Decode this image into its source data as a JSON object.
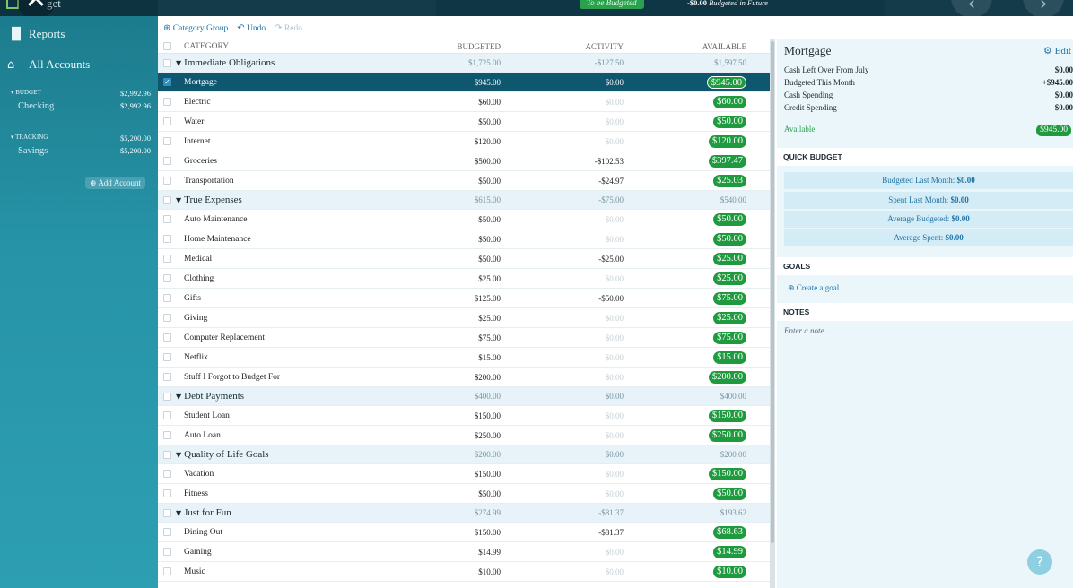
{
  "top": {
    "logo_text": "get",
    "to_be_budgeted": "To be Budgeted",
    "future_amount": "-$0.00",
    "future_label": "Budgeted in Future"
  },
  "sidebar": {
    "reports": "Reports",
    "all_accounts": "All Accounts",
    "budget_head": "BUDGET",
    "budget_total": "$2,992.96",
    "checking": "Checking",
    "checking_amt": "$2,992.96",
    "tracking_head": "TRACKING",
    "tracking_total": "$5,200.00",
    "savings": "Savings",
    "savings_amt": "$5,200.00",
    "add_account": "Add Account"
  },
  "toolbar": {
    "category_group": "Category Group",
    "undo": "Undo",
    "redo": "Redo"
  },
  "columns": {
    "category": "CATEGORY",
    "budgeted": "BUDGETED",
    "activity": "ACTIVITY",
    "available": "AVAILABLE"
  },
  "rows": [
    {
      "type": "group",
      "name": "Immediate Obligations",
      "budgeted": "$1,725.00",
      "activity": "-$127.50",
      "available": "$1,597.50"
    },
    {
      "type": "cat",
      "name": "Mortgage",
      "budgeted": "$945.00",
      "activity": "$0.00",
      "available": "$945.00",
      "selected": true
    },
    {
      "type": "cat",
      "name": "Electric",
      "budgeted": "$60.00",
      "activity": "$0.00",
      "available": "$60.00"
    },
    {
      "type": "cat",
      "name": "Water",
      "budgeted": "$50.00",
      "activity": "$0.00",
      "available": "$50.00"
    },
    {
      "type": "cat",
      "name": "Internet",
      "budgeted": "$120.00",
      "activity": "$0.00",
      "available": "$120.00"
    },
    {
      "type": "cat",
      "name": "Groceries",
      "budgeted": "$500.00",
      "activity": "-$102.53",
      "available": "$397.47"
    },
    {
      "type": "cat",
      "name": "Transportation",
      "budgeted": "$50.00",
      "activity": "-$24.97",
      "available": "$25.03"
    },
    {
      "type": "group",
      "name": "True Expenses",
      "budgeted": "$615.00",
      "activity": "-$75.00",
      "available": "$540.00"
    },
    {
      "type": "cat",
      "name": "Auto Maintenance",
      "budgeted": "$50.00",
      "activity": "$0.00",
      "available": "$50.00"
    },
    {
      "type": "cat",
      "name": "Home Maintenance",
      "budgeted": "$50.00",
      "activity": "$0.00",
      "available": "$50.00"
    },
    {
      "type": "cat",
      "name": "Medical",
      "budgeted": "$50.00",
      "activity": "-$25.00",
      "available": "$25.00"
    },
    {
      "type": "cat",
      "name": "Clothing",
      "budgeted": "$25.00",
      "activity": "$0.00",
      "available": "$25.00"
    },
    {
      "type": "cat",
      "name": "Gifts",
      "budgeted": "$125.00",
      "activity": "-$50.00",
      "available": "$75.00"
    },
    {
      "type": "cat",
      "name": "Giving",
      "budgeted": "$25.00",
      "activity": "$0.00",
      "available": "$25.00"
    },
    {
      "type": "cat",
      "name": "Computer Replacement",
      "budgeted": "$75.00",
      "activity": "$0.00",
      "available": "$75.00"
    },
    {
      "type": "cat",
      "name": "Netflix",
      "budgeted": "$15.00",
      "activity": "$0.00",
      "available": "$15.00"
    },
    {
      "type": "cat",
      "name": "Stuff I Forgot to Budget For",
      "budgeted": "$200.00",
      "activity": "$0.00",
      "available": "$200.00"
    },
    {
      "type": "group",
      "name": "Debt Payments",
      "budgeted": "$400.00",
      "activity": "$0.00",
      "available": "$400.00"
    },
    {
      "type": "cat",
      "name": "Student Loan",
      "budgeted": "$150.00",
      "activity": "$0.00",
      "available": "$150.00"
    },
    {
      "type": "cat",
      "name": "Auto Loan",
      "budgeted": "$250.00",
      "activity": "$0.00",
      "available": "$250.00"
    },
    {
      "type": "group",
      "name": "Quality of Life Goals",
      "budgeted": "$200.00",
      "activity": "$0.00",
      "available": "$200.00"
    },
    {
      "type": "cat",
      "name": "Vacation",
      "budgeted": "$150.00",
      "activity": "$0.00",
      "available": "$150.00"
    },
    {
      "type": "cat",
      "name": "Fitness",
      "budgeted": "$50.00",
      "activity": "$0.00",
      "available": "$50.00"
    },
    {
      "type": "group",
      "name": "Just for Fun",
      "budgeted": "$274.99",
      "activity": "-$81.37",
      "available": "$193.62"
    },
    {
      "type": "cat",
      "name": "Dining Out",
      "budgeted": "$150.00",
      "activity": "-$81.37",
      "available": "$68.63"
    },
    {
      "type": "cat",
      "name": "Gaming",
      "budgeted": "$14.99",
      "activity": "$0.00",
      "available": "$14.99"
    },
    {
      "type": "cat",
      "name": "Music",
      "budgeted": "$10.00",
      "activity": "$0.00",
      "available": "$10.00"
    }
  ],
  "inspector": {
    "title": "Mortgage",
    "edit": "Edit",
    "cash_left_label": "Cash Left Over From July",
    "cash_left": "$0.00",
    "budgeted_label": "Budgeted This Month",
    "budgeted": "+$945.00",
    "cash_spending_label": "Cash Spending",
    "cash_spending": "$0.00",
    "credit_spending_label": "Credit Spending",
    "credit_spending": "$0.00",
    "available_label": "Available",
    "available": "$945.00",
    "quick_budget": "QUICK BUDGET",
    "qb_last_month_label": "Budgeted Last Month:",
    "qb_last_month": "$0.00",
    "qb_spent_label": "Spent Last Month:",
    "qb_spent": "$0.00",
    "qb_avg_budgeted_label": "Average Budgeted:",
    "qb_avg_budgeted": "$0.00",
    "qb_avg_spent_label": "Average Spent:",
    "qb_avg_spent": "$0.00",
    "goals": "GOALS",
    "create_goal": "Create a goal",
    "notes": "NOTES",
    "note_placeholder": "Enter a note..."
  }
}
